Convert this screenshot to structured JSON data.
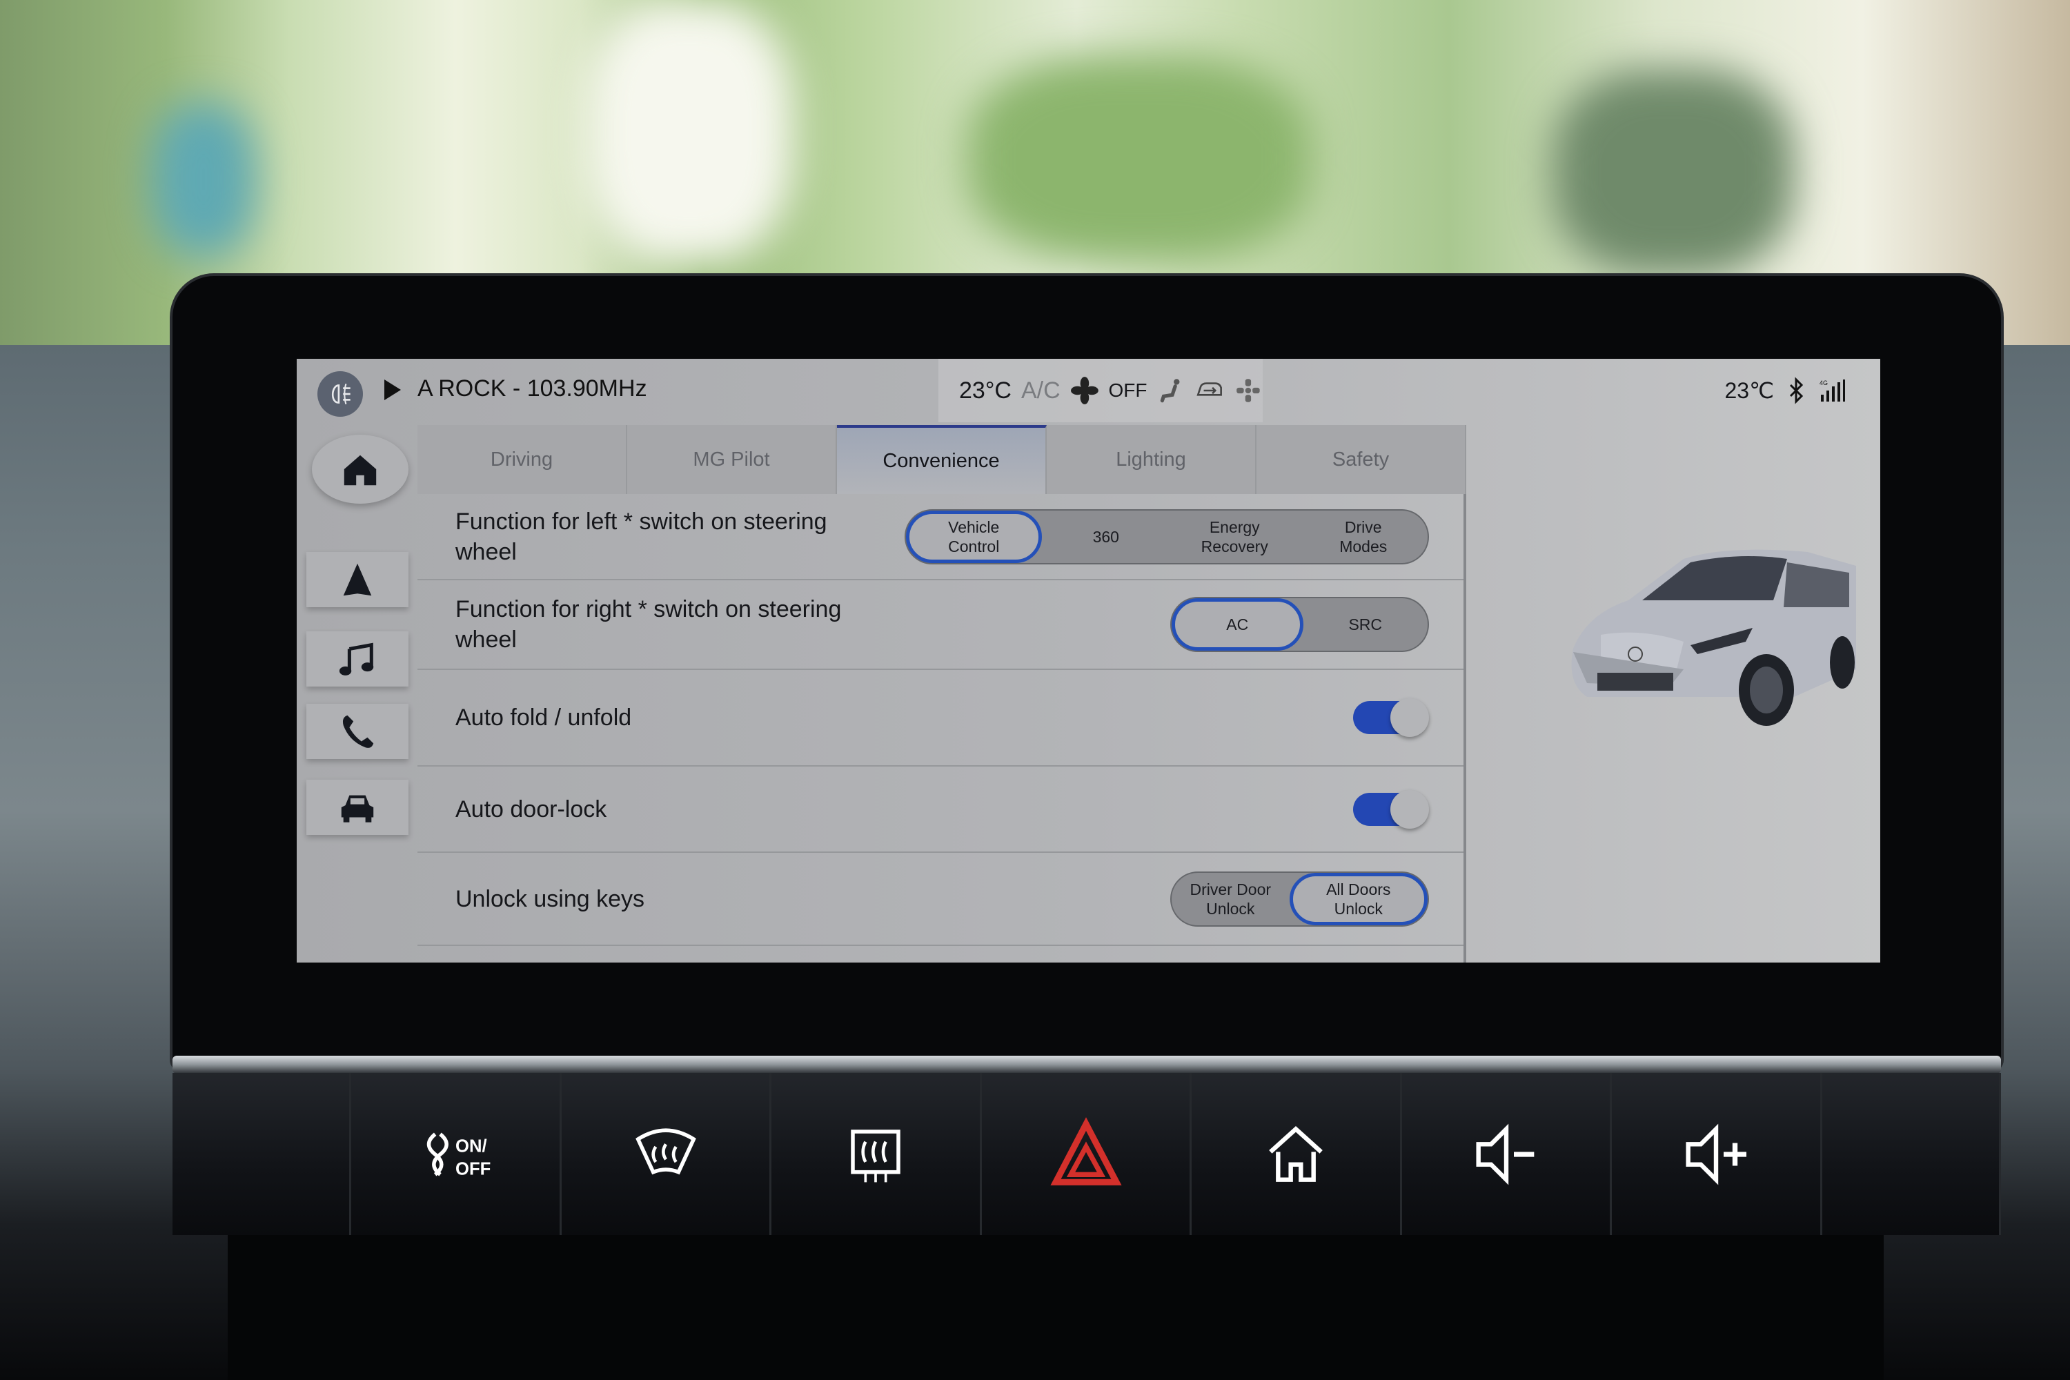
{
  "status_bar": {
    "fog_lamp_icon": "rear-fog-lamp-icon",
    "media_state": "playing",
    "radio_station": "A ROCK - 103.90MHz",
    "climate": {
      "temperature": "23°C",
      "ac_label": "A/C",
      "fan_label": "OFF",
      "icons": [
        "seat-heat-icon",
        "recirculation-icon",
        "airflow-icon"
      ]
    },
    "outside_temperature": "23℃",
    "bluetooth": "bluetooth-icon",
    "signal": "4G"
  },
  "dock": {
    "items": [
      {
        "icon": "home-icon",
        "label": "Home"
      },
      {
        "icon": "navigation-icon",
        "label": "Navigation"
      },
      {
        "icon": "music-icon",
        "label": "Media"
      },
      {
        "icon": "phone-icon",
        "label": "Phone"
      },
      {
        "icon": "car-icon",
        "label": "Vehicle"
      }
    ]
  },
  "tabs": [
    {
      "label": "Driving",
      "active": false
    },
    {
      "label": "MG Pilot",
      "active": false
    },
    {
      "label": "Convenience",
      "active": true
    },
    {
      "label": "Lighting",
      "active": false
    },
    {
      "label": "Safety",
      "active": false
    }
  ],
  "settings": {
    "left_switch": {
      "label": "Function for left * switch on steering wheel",
      "options": [
        "Vehicle Control",
        "360",
        "Energy Recovery",
        "Drive Modes"
      ],
      "selected": "Vehicle Control"
    },
    "right_switch": {
      "label": "Function for right * switch on steering wheel",
      "options": [
        "AC",
        "SRC"
      ],
      "selected": "AC"
    },
    "auto_fold": {
      "label": "Auto fold / unfold",
      "enabled": true
    },
    "auto_door_lock": {
      "label": "Auto door-lock",
      "enabled": true
    },
    "unlock_keys": {
      "label": "Unlock using keys",
      "options": [
        "Driver Door Unlock",
        "All Doors Unlock"
      ],
      "selected": "All Doors Unlock"
    }
  },
  "hardware_buttons": [
    {
      "icon": "fan-on-off-icon",
      "label": "ON/OFF"
    },
    {
      "icon": "front-defrost-icon"
    },
    {
      "icon": "rear-defrost-icon"
    },
    {
      "icon": "hazard-icon"
    },
    {
      "icon": "home-icon"
    },
    {
      "icon": "volume-down-icon"
    },
    {
      "icon": "volume-up-icon"
    }
  ],
  "colors": {
    "accent": "#2347b3",
    "hazard": "#d3302b",
    "active_tab_underline": "#2c3a8a"
  }
}
